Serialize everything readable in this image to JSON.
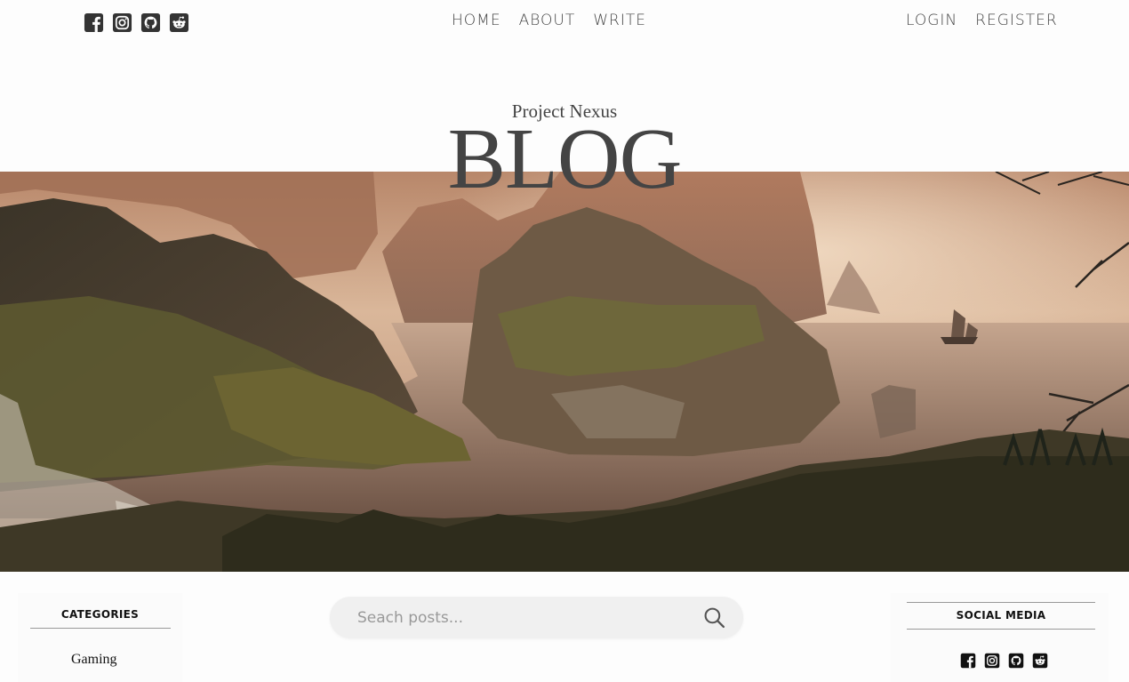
{
  "header": {
    "nav_center": [
      "HOME",
      "ABOUT",
      "WRITE"
    ],
    "nav_right": [
      "LOGIN",
      "REGISTER"
    ],
    "social_icons": [
      "facebook-icon",
      "instagram-icon",
      "github-icon",
      "reddit-icon"
    ]
  },
  "hero": {
    "subtitle": "Project Nexus",
    "title": "BLOG"
  },
  "sidebar_left": {
    "title": "CATEGORIES",
    "items": [
      "Gaming"
    ]
  },
  "search": {
    "placeholder": "Seach posts..."
  },
  "sidebar_right": {
    "title": "SOCIAL MEDIA",
    "icons": [
      "facebook-icon",
      "instagram-icon",
      "github-icon",
      "reddit-icon"
    ]
  },
  "colors": {
    "text": "#444444",
    "icon": "#333333",
    "background": "#fdfdfd",
    "search_bg": "#f0f0f0"
  }
}
